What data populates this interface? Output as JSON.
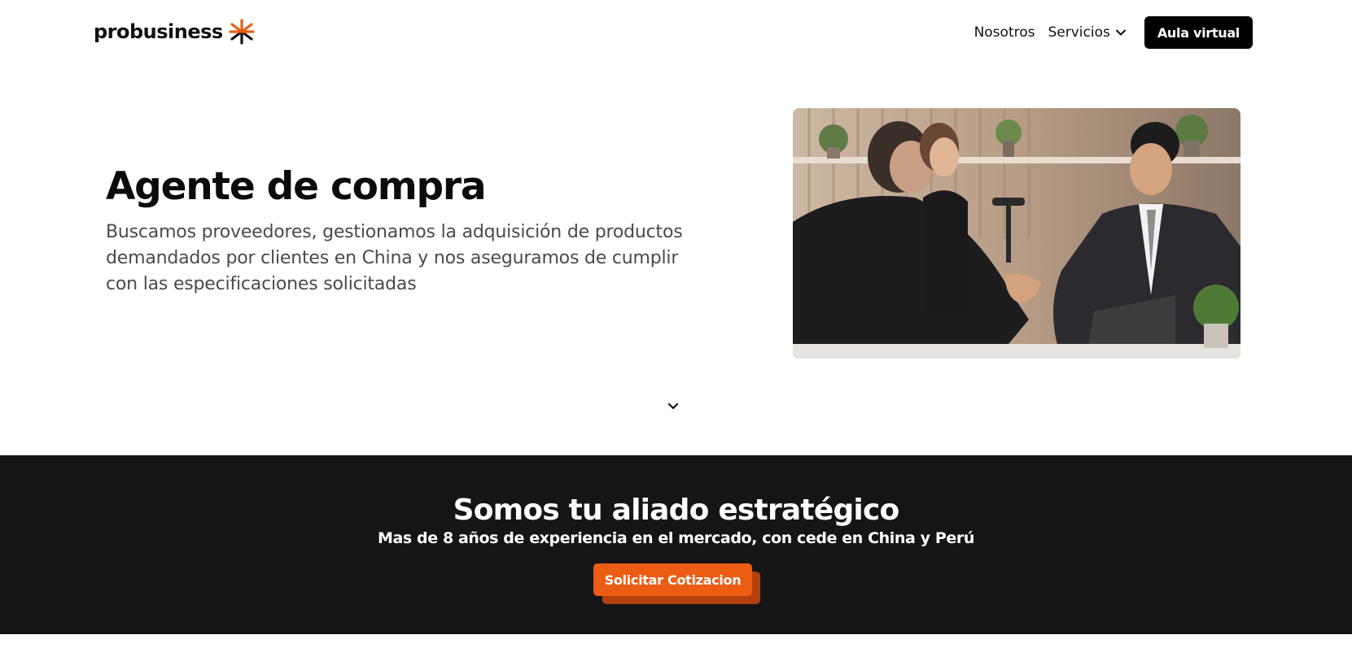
{
  "header": {
    "brand_name": "probusiness",
    "brand_icon": "asterisk-logo-icon",
    "nav": {
      "nosotros_label": "Nosotros",
      "servicios_label": "Servicios",
      "aula_label": "Aula virtual"
    }
  },
  "hero": {
    "title": "Agente de compra",
    "description": "Buscamos proveedores, gestionamos la adquisición de productos demandados por clientes en China y nos aseguramos de cumplir con las especificaciones solicitadas",
    "image_alt": "handshake-business-meeting-photo"
  },
  "band": {
    "title": "Somos tu aliado estratégico",
    "subtitle": "Mas de 8 años de experiencia en el mercado, con cede en China y Perú",
    "cta_label": "Solicitar Cotizacion"
  },
  "colors": {
    "accent": "#ec5d14",
    "accent_shadow": "#b6400d",
    "dark_band": "#151517",
    "button_dark": "#000000"
  }
}
